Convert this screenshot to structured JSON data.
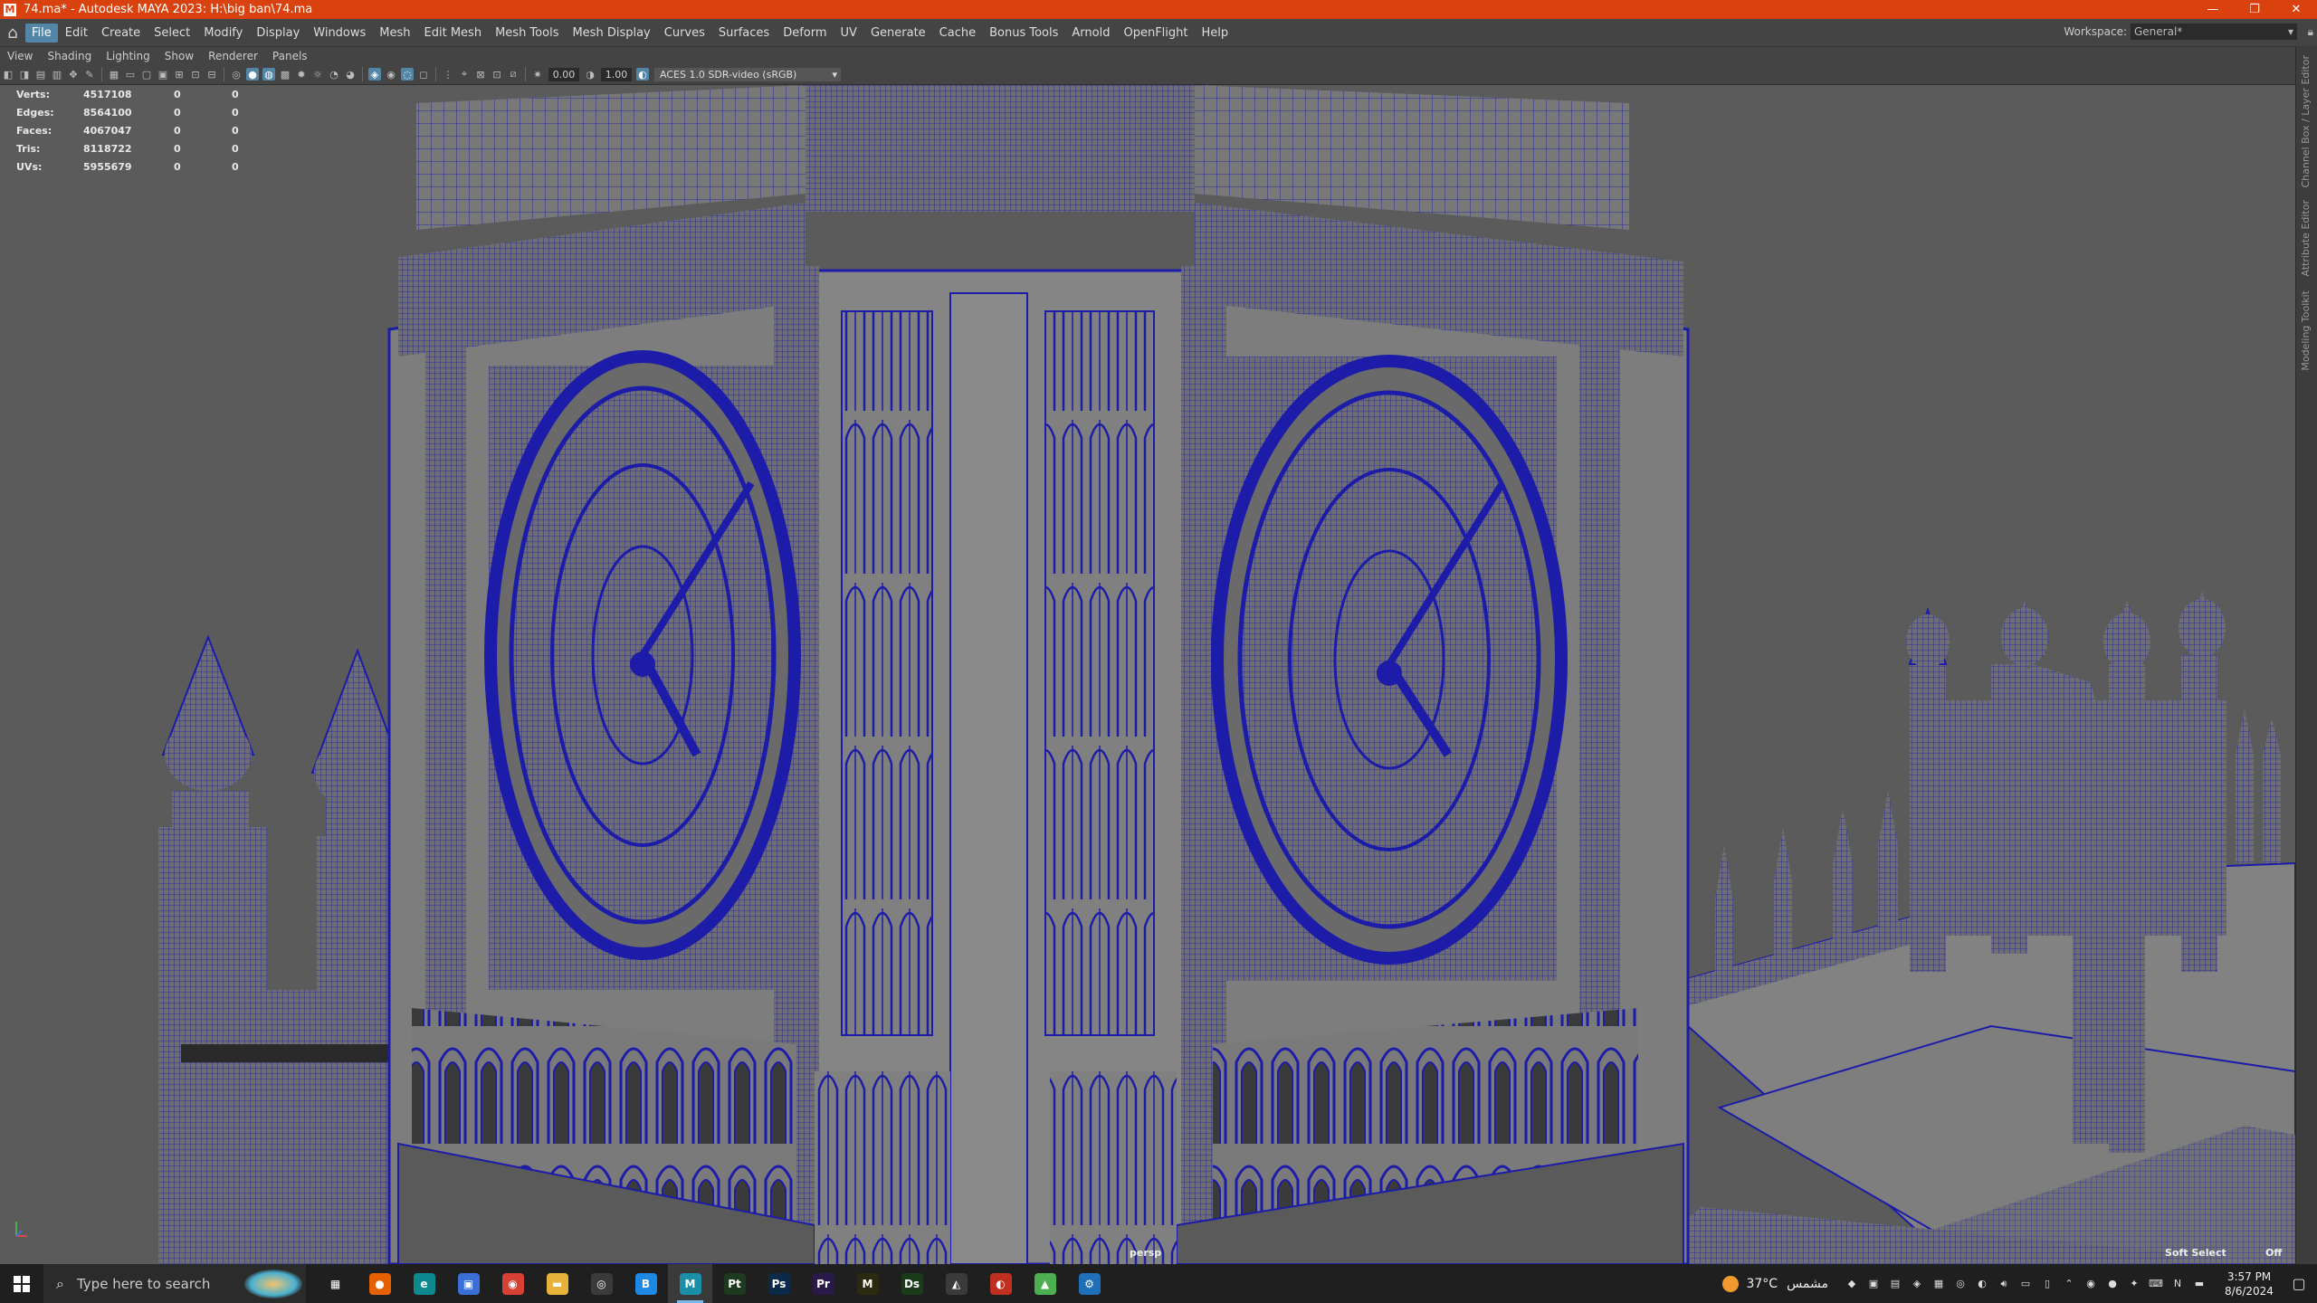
{
  "titlebar": {
    "title": "74.ma* - Autodesk MAYA 2023: H:\\big ban\\74.ma",
    "app_icon": "M",
    "minimize": "—",
    "restore": "❐",
    "close": "✕"
  },
  "menubar": {
    "items": [
      "File",
      "Edit",
      "Create",
      "Select",
      "Modify",
      "Display",
      "Windows",
      "Mesh",
      "Edit Mesh",
      "Mesh Tools",
      "Mesh Display",
      "Curves",
      "Surfaces",
      "Deform",
      "UV",
      "Generate",
      "Cache",
      "Bonus Tools",
      "Arnold",
      "OpenFlight",
      "Help"
    ],
    "active": "File",
    "workspace_label": "Workspace:",
    "workspace_value": "General*"
  },
  "panel_menu": [
    "View",
    "Shading",
    "Lighting",
    "Show",
    "Renderer",
    "Panels"
  ],
  "panel_toolbar": {
    "exposure": "0.00",
    "gamma": "1.00",
    "color_management": "ACES 1.0 SDR-video (sRGB)"
  },
  "hud": {
    "rows": [
      {
        "label": "Verts:",
        "a": "4517108",
        "b": "0",
        "c": "0"
      },
      {
        "label": "Edges:",
        "a": "8564100",
        "b": "0",
        "c": "0"
      },
      {
        "label": "Faces:",
        "a": "4067047",
        "b": "0",
        "c": "0"
      },
      {
        "label": "Tris:",
        "a": "8118722",
        "b": "0",
        "c": "0"
      },
      {
        "label": "UVs:",
        "a": "5955679",
        "b": "0",
        "c": "0"
      }
    ]
  },
  "viewport": {
    "camera": "persp",
    "soft_select": "Soft Select",
    "soft_select_state": "Off",
    "wire_color": "#1c1ca8",
    "shade_color": "#7a7a7a"
  },
  "side_tabs": [
    "Channel Box / Layer Editor",
    "Attribute Editor",
    "Modeling Toolkit"
  ],
  "taskbar": {
    "search_placeholder": "Type here to search",
    "apps": [
      {
        "name": "task-view",
        "glyph": "▦",
        "color": "#1f1f1f"
      },
      {
        "name": "firefox",
        "glyph": "●",
        "color": "#e66000"
      },
      {
        "name": "edge",
        "glyph": "e",
        "color": "#0c8a8f"
      },
      {
        "name": "store",
        "glyph": "▣",
        "color": "#3a6fd8"
      },
      {
        "name": "chrome",
        "glyph": "◉",
        "color": "#d64134"
      },
      {
        "name": "file-explorer",
        "glyph": "▬",
        "color": "#e6b23a"
      },
      {
        "name": "search-app",
        "glyph": "◎",
        "color": "#3a3a3a"
      },
      {
        "name": "app-blue",
        "glyph": "B",
        "color": "#1e88e5"
      },
      {
        "name": "maya",
        "glyph": "M",
        "color": "#1b8fa8"
      },
      {
        "name": "painter",
        "glyph": "Pt",
        "color": "#1e3a1e"
      },
      {
        "name": "photoshop",
        "glyph": "Ps",
        "color": "#0b2a4a"
      },
      {
        "name": "premiere",
        "glyph": "Pr",
        "color": "#2a1a4a"
      },
      {
        "name": "marvelous",
        "glyph": "M",
        "color": "#2a2a10"
      },
      {
        "name": "substance-designer",
        "glyph": "Ds",
        "color": "#1a3a1a"
      },
      {
        "name": "photos",
        "glyph": "◭",
        "color": "#3a3a3a"
      },
      {
        "name": "app-red",
        "glyph": "◐",
        "color": "#c03020"
      },
      {
        "name": "app-green",
        "glyph": "▲",
        "color": "#4caf50"
      },
      {
        "name": "settings",
        "glyph": "⚙",
        "color": "#1e6fb8"
      }
    ],
    "active_app": "maya",
    "temperature": "37°C",
    "weather_text": "مشمس",
    "time": "3:57 PM",
    "date": "8/6/2024"
  }
}
